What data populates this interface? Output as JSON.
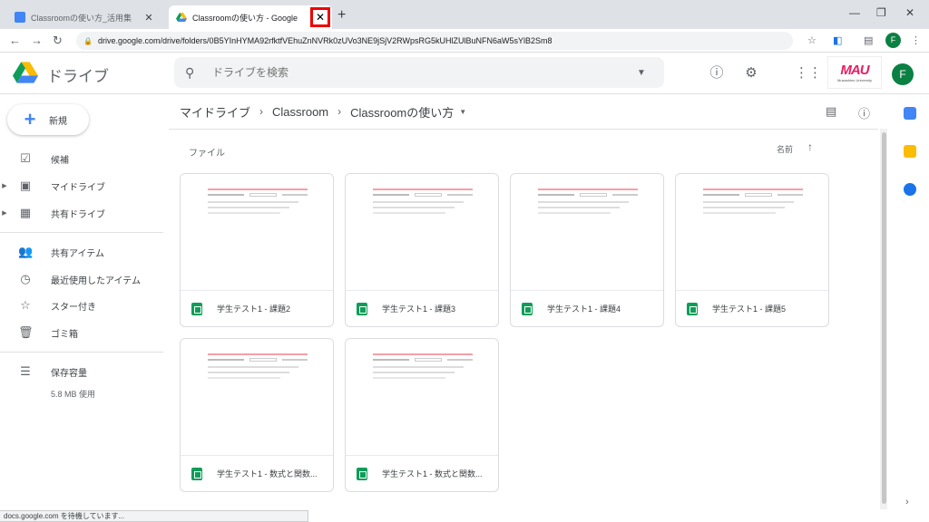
{
  "browser": {
    "tabs": [
      {
        "title": "Classroomの使い方_活用集"
      },
      {
        "title": "Classroomの使い方 - Google ドライブ"
      }
    ],
    "newtab_glyph": "+",
    "url": "drive.google.com/drive/folders/0B5YInHYMA92rfktfVEhuZnNVRk0zUVo3NE9jSjV2RWpsRG5kUHlZUlBuNFN6aW5sYlB2Sm8",
    "profile_initial": "F"
  },
  "drive": {
    "app_title": "ドライブ",
    "search_placeholder": "ドライブを検索",
    "brand_mark": "MAU",
    "brand_sub": "Musashino University",
    "avatar_initial": "F"
  },
  "sidebar": {
    "new_label": "新規",
    "items": [
      {
        "label": "候補",
        "icon": "priority-icon"
      },
      {
        "label": "マイドライブ",
        "icon": "my-drive-icon"
      },
      {
        "label": "共有ドライブ",
        "icon": "shared-drives-icon"
      },
      {
        "label": "共有アイテム",
        "icon": "shared-with-me-icon"
      },
      {
        "label": "最近使用したアイテム",
        "icon": "recent-icon"
      },
      {
        "label": "スター付き",
        "icon": "star-icon"
      },
      {
        "label": "ゴミ箱",
        "icon": "trash-icon"
      },
      {
        "label": "保存容量",
        "icon": "storage-icon"
      }
    ],
    "storage_used": "5.8 MB 使用"
  },
  "breadcrumb": [
    "マイドライブ",
    "Classroom",
    "Classroomの使い方"
  ],
  "main": {
    "section_label": "ファイル",
    "sort_label": "名前",
    "files": [
      {
        "name": "学生テスト1 - 課題2"
      },
      {
        "name": "学生テスト1 - 課題3"
      },
      {
        "name": "学生テスト1 - 課題4"
      },
      {
        "name": "学生テスト1 - 課題5"
      },
      {
        "name": "学生テスト1 - 数式と関数..."
      },
      {
        "name": "学生テスト1 - 数式と関数..."
      }
    ]
  },
  "status_bar": "docs.google.com を待機しています...",
  "colors": {
    "accent_blue": "#4285f4",
    "sheets_green": "#0f9d58",
    "highlight_red": "#e00000",
    "avatar_green": "#0b8043"
  }
}
